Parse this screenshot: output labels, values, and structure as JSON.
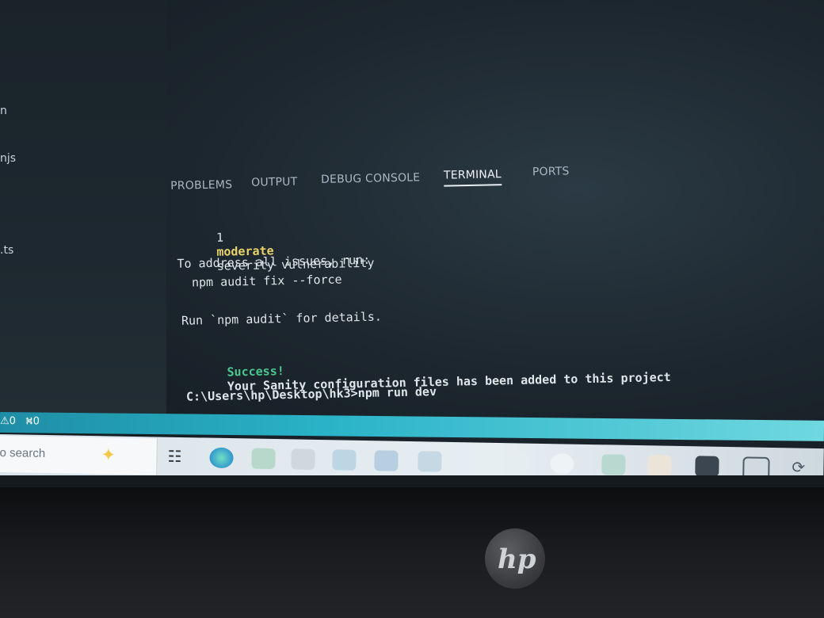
{
  "sidebar": {
    "items": [
      {
        "label": "n"
      },
      {
        "label": "njs"
      },
      {
        "label": ".ts"
      }
    ]
  },
  "panel": {
    "tabs": [
      {
        "label": "PROBLEMS"
      },
      {
        "label": "OUTPUT"
      },
      {
        "label": "DEBUG CONSOLE"
      },
      {
        "label": "TERMINAL",
        "active": true
      },
      {
        "label": "PORTS"
      }
    ]
  },
  "terminal": {
    "vuln_count": "1",
    "vuln_level": "moderate",
    "vuln_rest": "severity vulnerability",
    "address_line": "To address all issues, run:",
    "fix_cmd": "npm audit fix --force",
    "details_line": "Run `npm audit` for details.",
    "success_word": "Success!",
    "success_msg": "Your Sanity configuration files has been added to this project",
    "prompt_line": "C:\\Users\\hp\\Desktop\\hk3>npm run dev"
  },
  "statusbar": {
    "errors": "0",
    "ports": "0"
  },
  "taskbar": {
    "search_placeholder": "o search"
  },
  "colors": {
    "accent_status": "#2ab3c8",
    "success": "#49c98f",
    "moderate": "#e9d36a"
  },
  "icons": [
    "sparkle-icon",
    "task-view-icon",
    "edge-icon",
    "app-icon",
    "store-icon",
    "explorer-icon",
    "mail-icon",
    "photos-icon",
    "chat-icon",
    "app-round-icon",
    "office-icon",
    "files-icon",
    "photo-icon",
    "window-icon",
    "refresh-icon",
    "hp-logo"
  ]
}
